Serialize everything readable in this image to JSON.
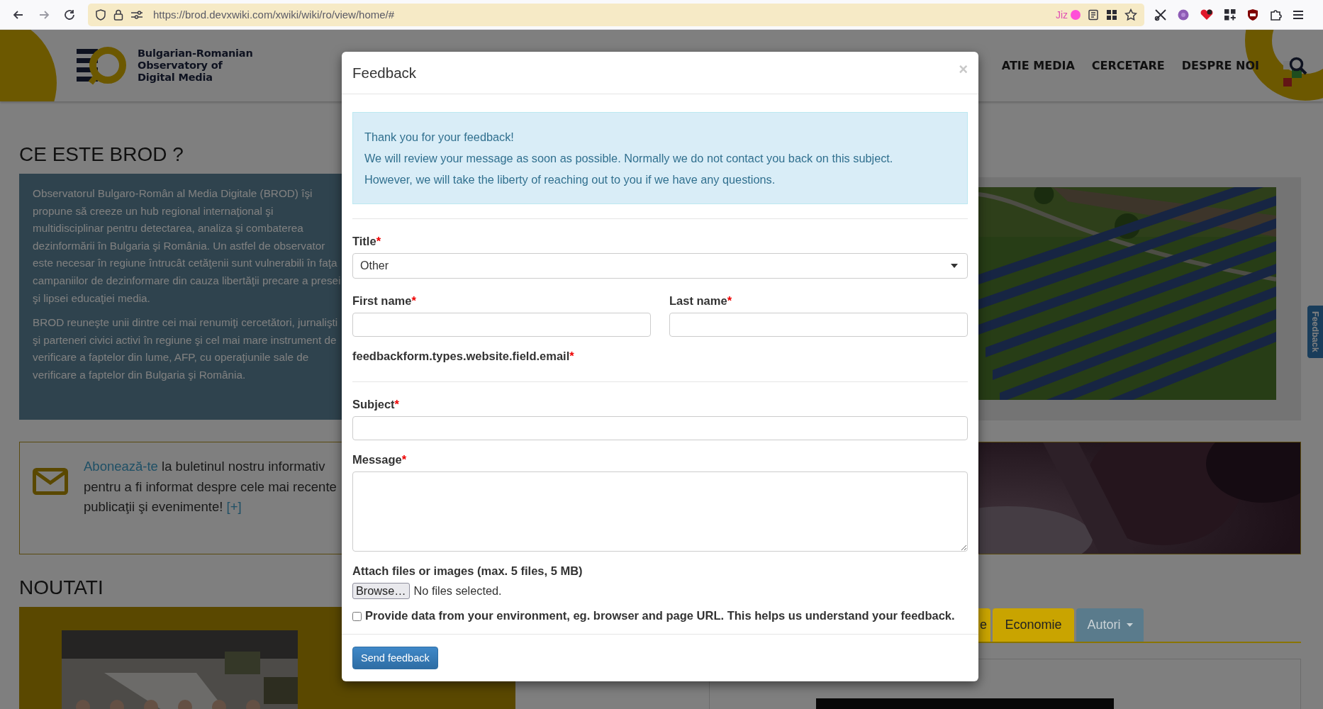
{
  "browser": {
    "url": "https://brod.devxwiki.com/xwiki/wiki/ro/view/home/#",
    "extension_label": "Jiz"
  },
  "site": {
    "logo_lines": [
      "Bulgarian-Romanian",
      "Observatory of",
      "Digital Media"
    ],
    "nav": [
      "ATIE MEDIA",
      "CERCETARE",
      "DESPRE NOI"
    ]
  },
  "about": {
    "heading": "CE ESTE BROD ?",
    "paragraphs": [
      "Observatorul Bulgaro-Român al Media Digitale (BROD) îşi propune să creeze un hub regional internaţional şi multidisciplinar pentru detectarea, analiza şi combaterea dezinformării în Bulgaria şi România. Un astfel de observator este necesar în regiune întrucât cetăţenii sunt vulnerabili în faţa campaniilor de dezinformare din cauza libertăţii precare a presei şi lipsei educaţiei media.",
      "BROD reuneşte unii dintre cei mai renumiţi cercetători, jurnalişti şi parteneri civici activi în regiune şi cel mai mare instrument de verificare a faptelor din lume, AFP, cu operaţiunile sale de verificare a faptelor din Bulgaria şi România."
    ]
  },
  "subscribe": {
    "link": "Abonează-te",
    "text": " la buletinul nostru informativ pentru a fi informat despre cele mai recente publicaţii şi evenimente!",
    "more": "[+]"
  },
  "news": {
    "heading": "NOUTATI",
    "tabs": [
      {
        "label": "e",
        "kind": "category"
      },
      {
        "label": "Economie",
        "kind": "category"
      },
      {
        "label": "Autori",
        "kind": "dropdown"
      }
    ]
  },
  "feedback_tab": {
    "label": "Feedback"
  },
  "modal": {
    "title": "Feedback",
    "close": "×",
    "alert_lines": [
      "Thank you for your feedback!",
      "We will review your message as soon as possible. Normally we do not contact you back on this subject.",
      "However, we will take the liberty of reaching out to you if we have any questions."
    ],
    "fields": [
      {
        "kind": "select",
        "label": "Title",
        "required_mark": "*",
        "value": "Other"
      },
      {
        "kind": "text_pair",
        "items": [
          {
            "label": "First name",
            "required_mark": "*"
          },
          {
            "label": "Last name",
            "required_mark": "*"
          }
        ]
      },
      {
        "kind": "label_only",
        "label": "feedbackform.types.website.field.email",
        "required_mark": "*"
      },
      {
        "kind": "divider"
      },
      {
        "kind": "text",
        "label": "Subject",
        "required_mark": "*"
      },
      {
        "kind": "textarea",
        "label": "Message",
        "required_mark": "*"
      },
      {
        "kind": "file",
        "label": "Attach files or images (max. 5 files, 5 MB)",
        "button": "Browse…",
        "status": "No files selected."
      },
      {
        "kind": "checkbox",
        "label": "Provide data from your environment, eg. browser and page URL. This helps us understand your feedback.",
        "checked": false
      }
    ],
    "submit": "Send feedback"
  }
}
